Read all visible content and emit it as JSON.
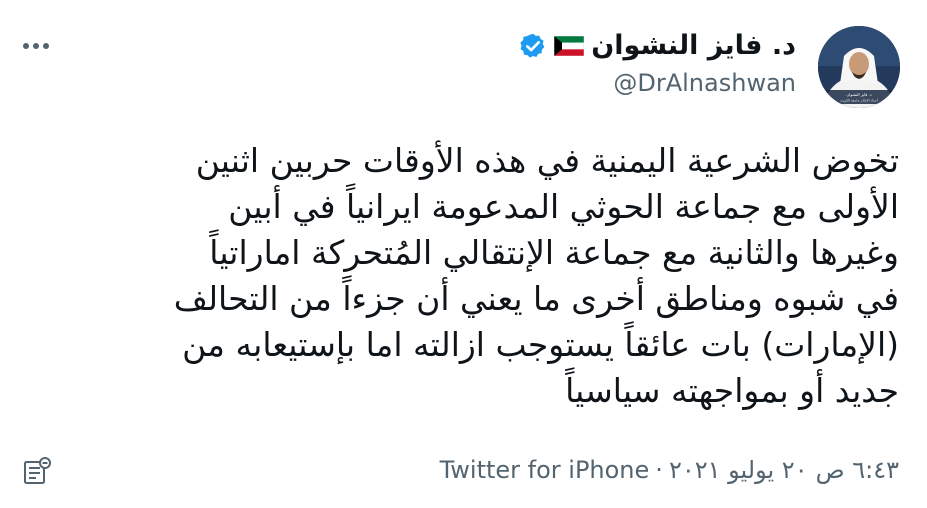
{
  "author": {
    "display_name": "د. فايز النشوان",
    "handle": "@DrAlnashwan",
    "flag_icon": "kuwait-flag-icon",
    "verified_icon": "verified-badge-icon",
    "avatar_caption": "د. فايز النشوان",
    "avatar_subcaption": "أستاذ الإعلام جامعة الكويت"
  },
  "tweet": {
    "lines": [
      "تخوض الشرعية اليمنية في هذه الأوقات حربين اثنين",
      "الأولى مع جماعة الحوثي المدعومة ايرانياً في أبين",
      "وغيرها والثانية مع جماعة الإنتقالي المُتحركة اماراتياً",
      "في شبوه ومناطق أخرى ما يعني أن جزءاً من التحالف",
      "(الإمارات) بات عائقاً يستوجب ازالته اما بإستيعابه من",
      "جديد أو بمواجهته سياسياً"
    ]
  },
  "meta": {
    "time": "٦:٤٣ ص",
    "date": "٢٠ يوليو ٢٠٢١",
    "separator": "·",
    "source": "Twitter for iPhone"
  },
  "icons": {
    "more": "more-options-icon",
    "analytics": "view-analytics-icon"
  },
  "colors": {
    "text": "#0f1419",
    "secondary": "#536471",
    "verified": "#1d9bf0"
  }
}
